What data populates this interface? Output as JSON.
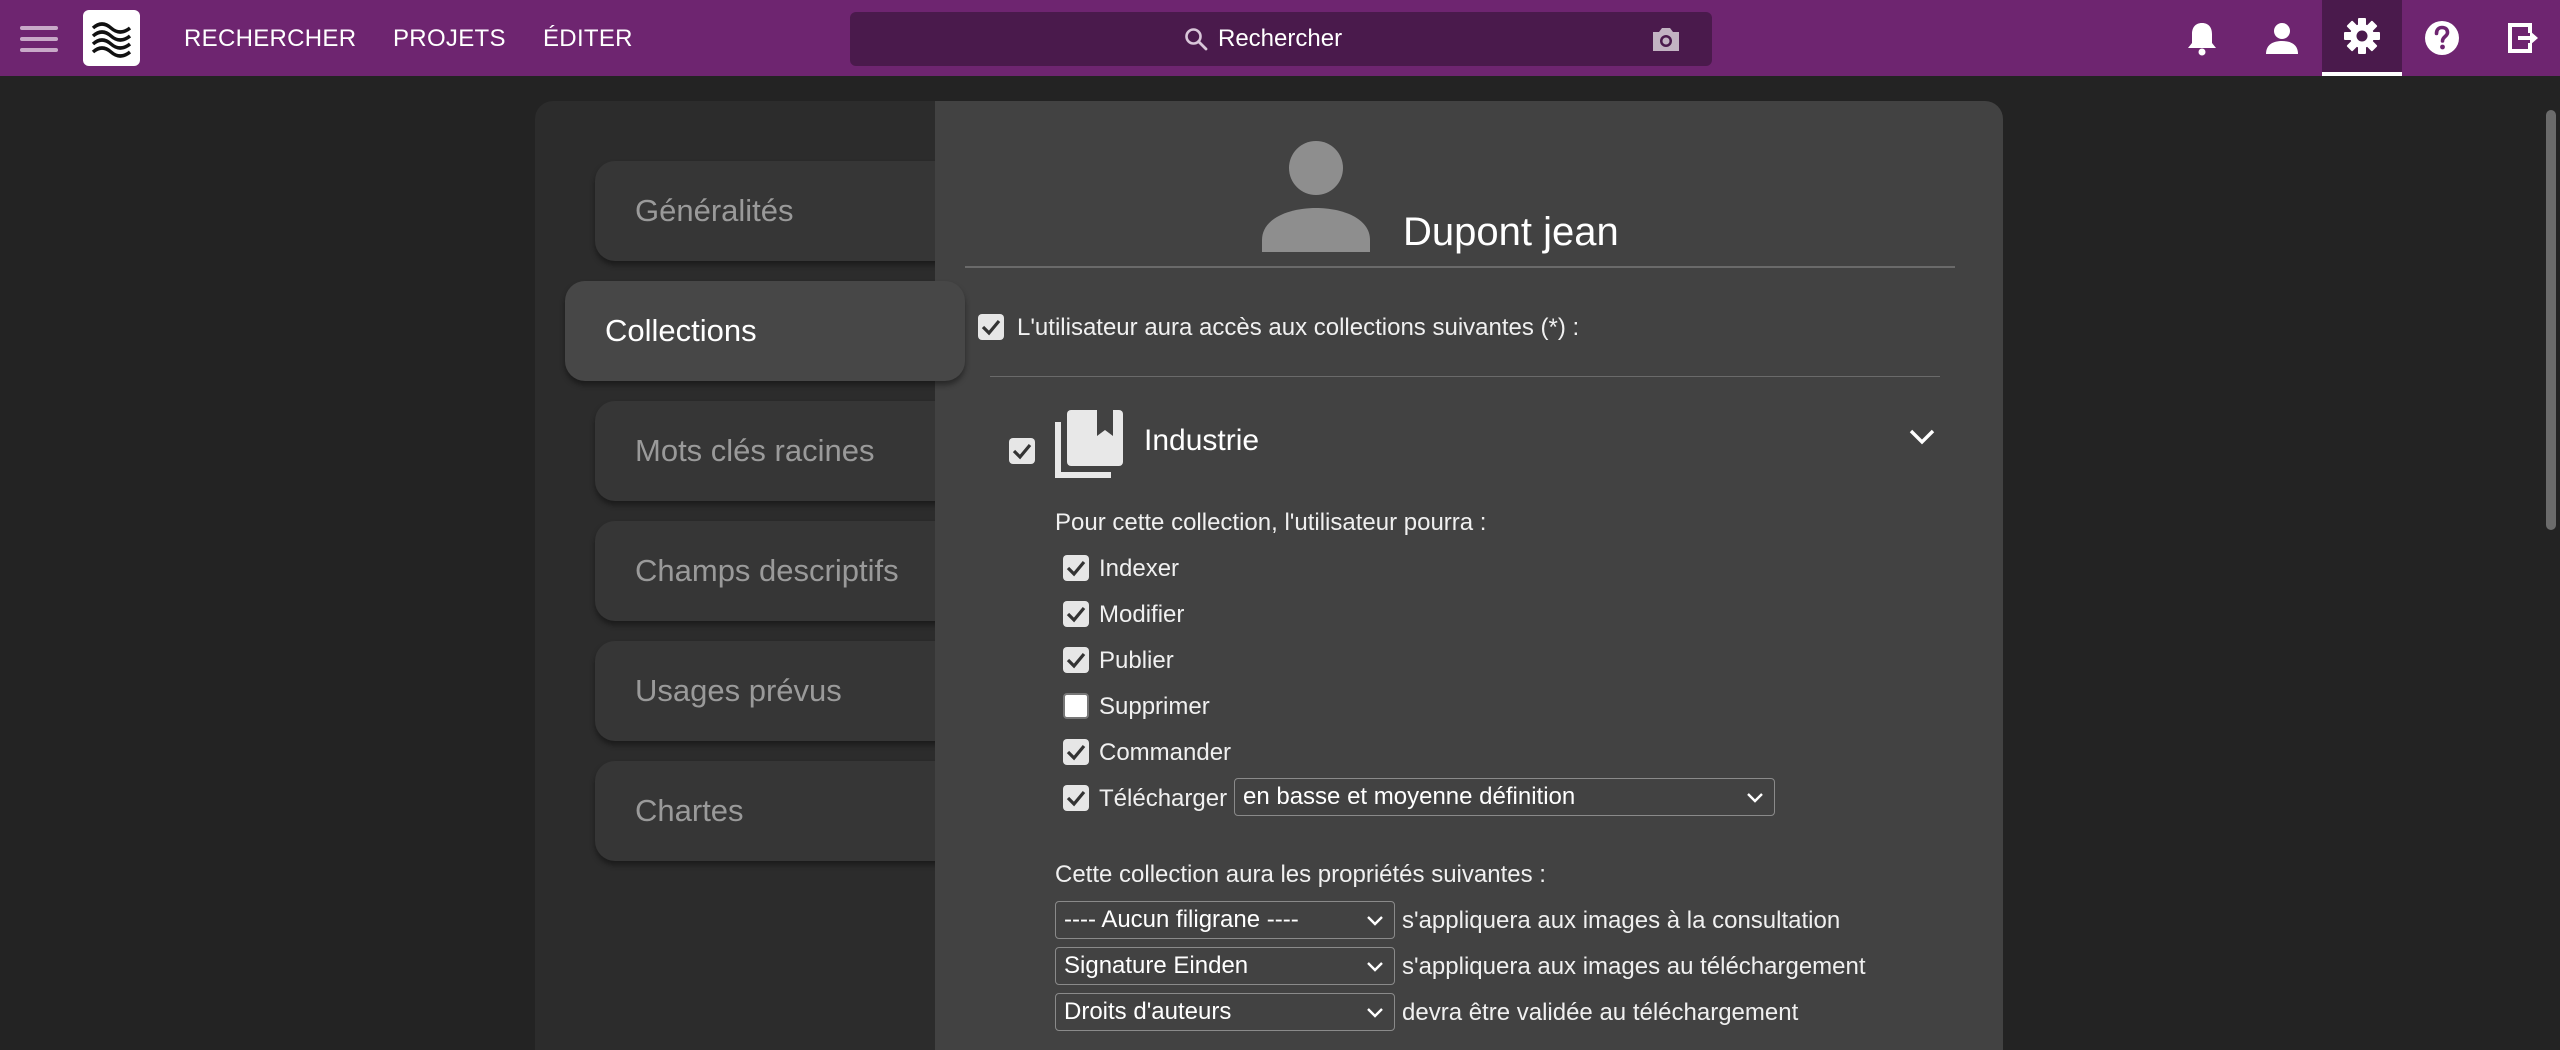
{
  "nav": {
    "search": "RECHERCHER",
    "projects": "PROJETS",
    "edit": "ÉDITER"
  },
  "search": {
    "placeholder": "Rechercher"
  },
  "sidebar": {
    "items": [
      {
        "label": "Généralités"
      },
      {
        "label": "Collections"
      },
      {
        "label": "Mots clés racines"
      },
      {
        "label": "Champs descriptifs"
      },
      {
        "label": "Usages prévus"
      },
      {
        "label": "Chartes"
      }
    ],
    "active": "Collections"
  },
  "user": {
    "name": "Dupont jean"
  },
  "access": {
    "label": "L'utilisateur aura accès aux collections suivantes (*) :",
    "checked": true
  },
  "collection": {
    "name": "Industrie",
    "checked": true,
    "permissions_intro": "Pour cette collection, l'utilisateur pourra :",
    "permissions": [
      {
        "label": "Indexer",
        "checked": true
      },
      {
        "label": "Modifier",
        "checked": true
      },
      {
        "label": "Publier",
        "checked": true
      },
      {
        "label": "Supprimer",
        "checked": false
      },
      {
        "label": "Commander",
        "checked": true
      },
      {
        "label": "Télécharger",
        "checked": true
      }
    ],
    "download_definition": "en basse et moyenne définition",
    "properties_intro": "Cette collection aura les propriétés suivantes :",
    "properties": [
      {
        "value": "---- Aucun filigrane ----",
        "suffix": "s'appliquera aux images à la consultation"
      },
      {
        "value": "Signature Einden",
        "suffix": "s'appliquera aux images au téléchargement"
      },
      {
        "value": "Droits d'auteurs",
        "suffix": "devra être validée au téléchargement"
      }
    ]
  },
  "icons": [
    "menu-icon",
    "logo-icon",
    "search-icon",
    "camera-icon",
    "bell-icon",
    "user-icon",
    "gear-icon",
    "help-icon",
    "logout-icon",
    "chevron-down-icon",
    "collection-icon",
    "avatar-icon"
  ],
  "colors": {
    "topbar": "#6e2570",
    "topbar_dark": "#4a1a4c",
    "background": "#232323",
    "panel": "#424242"
  }
}
